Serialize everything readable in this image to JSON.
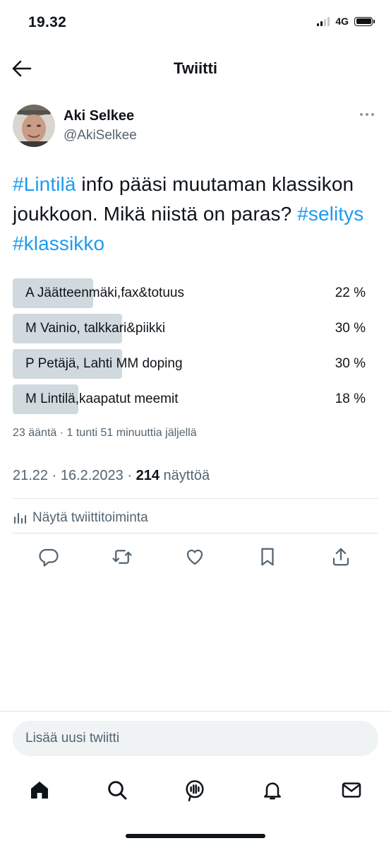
{
  "status_bar": {
    "time": "19.32",
    "network": "4G"
  },
  "header": {
    "title": "Twiitti"
  },
  "author": {
    "name": "Aki Selkee",
    "handle": "@AkiSelkee"
  },
  "tweet": {
    "segments": [
      {
        "text": "#Lintilä",
        "hashtag": true
      },
      {
        "text": " info pääsi muutaman klassikon joukkoon. Mikä niistä on paras? ",
        "hashtag": false
      },
      {
        "text": "#selitys",
        "hashtag": true
      },
      {
        "text": " ",
        "hashtag": false
      },
      {
        "text": "#klassikko",
        "hashtag": true
      }
    ]
  },
  "poll": {
    "options": [
      {
        "label": "A Jäätteenmäki,fax&totuus",
        "percent_text": "22 %",
        "percent": 22
      },
      {
        "label": "M Vainio, talkkari&piikki",
        "percent_text": "30 %",
        "percent": 30
      },
      {
        "label": "P Petäjä, Lahti MM doping",
        "percent_text": "30 %",
        "percent": 30
      },
      {
        "label": "M Lintilä,kaapatut meemit",
        "percent_text": "18 %",
        "percent": 18
      }
    ],
    "meta": "23 ääntä · 1 tunti 51 minuuttia jäljellä"
  },
  "timestamp": {
    "time": "21.22 · 16.2.2023 · ",
    "views_count": "214",
    "views_label": " näyttöä"
  },
  "activity": {
    "label": "Näytä twiittitoiminta"
  },
  "actions": [
    "reply-icon",
    "retweet-icon",
    "like-icon",
    "bookmark-icon",
    "share-icon"
  ],
  "compose": {
    "placeholder": "Lisää uusi twiitti"
  },
  "bottom_nav": [
    "home-icon",
    "search-icon",
    "spaces-icon",
    "notifications-icon",
    "messages-icon"
  ],
  "colors": {
    "accent": "#1d9bf0",
    "text": "#0f1419",
    "secondary": "#536471",
    "poll_bar": "#cfd9de"
  }
}
